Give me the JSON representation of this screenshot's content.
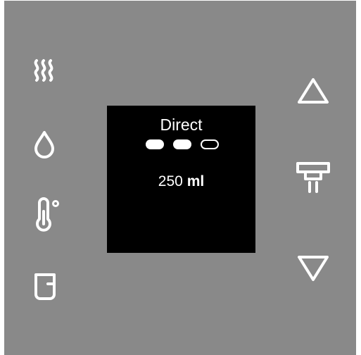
{
  "display": {
    "mode_label": "Direct",
    "strength": {
      "level": 2,
      "max": 3
    },
    "volume": {
      "value": "250",
      "unit": "ml"
    }
  },
  "left_buttons": [
    {
      "name": "steam",
      "icon": "steam-icon"
    },
    {
      "name": "hot-water",
      "icon": "water-drop-icon"
    },
    {
      "name": "temperature",
      "icon": "thermometer-icon"
    },
    {
      "name": "milk-jug",
      "icon": "jug-icon"
    }
  ],
  "right_buttons": [
    {
      "name": "up",
      "icon": "triangle-up-icon"
    },
    {
      "name": "brew",
      "icon": "coffee-spout-icon"
    },
    {
      "name": "down",
      "icon": "triangle-down-icon"
    }
  ],
  "colors": {
    "panel": "#898989",
    "screen": "#000000",
    "foreground": "#ffffff"
  }
}
